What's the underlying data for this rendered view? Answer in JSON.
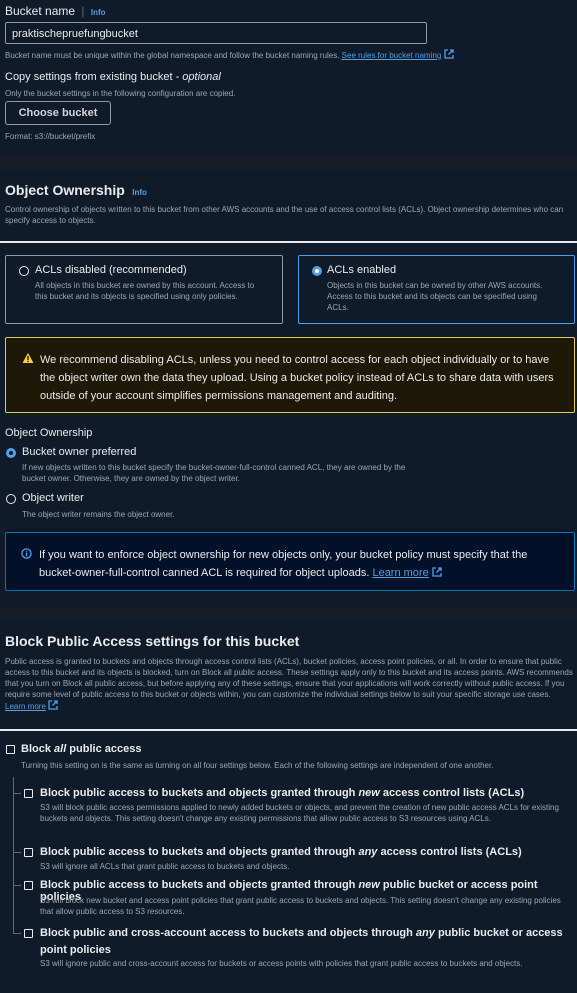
{
  "bucket_name": {
    "label": "Bucket name",
    "info": "Info",
    "value": "praktischepruefungbucket",
    "help_text": "Bucket name must be unique within the global namespace and follow the bucket naming rules.",
    "help_link": "See rules for bucket naming"
  },
  "copy_settings": {
    "label_prefix": "Copy settings from existing bucket - ",
    "label_optional": "optional",
    "description": "Only the bucket settings in the following configuration are copied.",
    "button": "Choose bucket",
    "format": "Format: s3://bucket/prefix"
  },
  "object_ownership": {
    "title": "Object Ownership",
    "info": "Info",
    "description": "Control ownership of objects written to this bucket from other AWS accounts and the use of access control lists (ACLs). Object ownership determines who can specify access to objects.",
    "options": [
      {
        "label": "ACLs disabled (recommended)",
        "description": "All objects in this bucket are owned by this account. Access to this bucket and its objects is specified using only policies.",
        "selected": false
      },
      {
        "label": "ACLs enabled",
        "description": "Objects in this bucket can be owned by other AWS accounts. Access to this bucket and its objects can be specified using ACLs.",
        "selected": true
      }
    ],
    "warning": "We recommend disabling ACLs, unless you need to control access for each object individually or to have the object writer own the data they upload. Using a bucket policy instead of ACLs to share data with users outside of your account simplifies permissions management and auditing.",
    "sub_label": "Object Ownership",
    "sub_options": [
      {
        "label": "Bucket owner preferred",
        "description": "If new objects written to this bucket specify the bucket-owner-full-control canned ACL, they are owned by the bucket owner. Otherwise, they are owned by the object writer.",
        "selected": true
      },
      {
        "label": "Object writer",
        "description": "The object writer remains the object owner.",
        "selected": false
      }
    ],
    "info_alert": "If you want to enforce object ownership for new objects only, your bucket policy must specify that the bucket-owner-full-control canned ACL is required for object uploads.",
    "info_link": "Learn more"
  },
  "block_public_access": {
    "title": "Block Public Access settings for this bucket",
    "description": "Public access is granted to buckets and objects through access control lists (ACLs), bucket policies, access point policies, or all. In order to ensure that public access to this bucket and its objects is blocked, turn on Block all public access. These settings apply only to this bucket and its access points. AWS recommends that you turn on Block all public access, but before applying any of these settings, ensure that your applications will work correctly without public access. If you require some level of public access to this bucket or objects within, you can customize the individual settings below to suit your specific storage use cases.",
    "link": "Learn more",
    "block_all": {
      "pre": "Block ",
      "em": "all",
      "post": " public access",
      "description": "Turning this setting on is the same as turning on all four settings below. Each of the following settings are independent of one another.",
      "checked": false
    },
    "settings": [
      {
        "pre": "Block public access to buckets and objects granted through ",
        "em": "new",
        "post": " access control lists (ACLs)",
        "description": "S3 will block public access permissions applied to newly added buckets or objects, and prevent the creation of new public access ACLs for existing buckets and objects. This setting doesn't change any existing permissions that allow public access to S3 resources using ACLs.",
        "checked": false
      },
      {
        "pre": "Block public access to buckets and objects granted through ",
        "em": "any",
        "post": " access control lists (ACLs)",
        "description": "S3 will ignore all ACLs that grant public access to buckets and objects.",
        "checked": false
      },
      {
        "pre": "Block public access to buckets and objects granted through ",
        "em": "new",
        "post": " public bucket or access point policies",
        "description": "S3 will block new bucket and access point policies that grant public access to buckets and objects. This setting doesn't change any existing policies that allow public access to S3 resources.",
        "checked": false
      },
      {
        "pre": "Block public and cross-account access to buckets and objects through ",
        "em": "any",
        "post": " public bucket or access point policies",
        "description": "S3 will ignore public and cross-account access for buckets or access points with policies that grant public access to buckets and objects.",
        "checked": false
      }
    ]
  },
  "colors": {
    "background": "#0f1b2a",
    "separator": "#161d26",
    "accent": "#539fe5",
    "warning_bg": "#1d1906",
    "warning_border": "#e0ca57",
    "warning_icon": "#fbd332",
    "info_bg": "#001129",
    "info_border": "#0073bb"
  }
}
